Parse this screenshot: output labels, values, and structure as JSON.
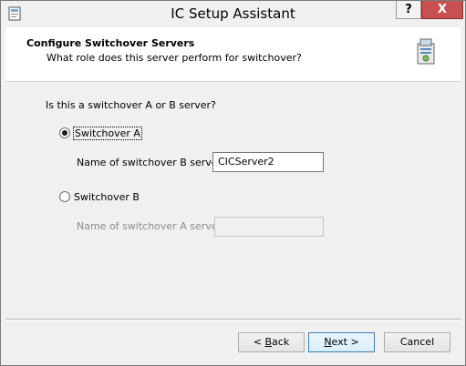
{
  "window": {
    "title": "IC Setup Assistant",
    "help_label": "?",
    "close_label": "X"
  },
  "header": {
    "title": "Configure Switchover Servers",
    "subtitle": "What role does this server perform for switchover?"
  },
  "main": {
    "question": "Is this a switchover A or B server?",
    "option_a": {
      "label": "Switchover A",
      "selected": true,
      "field_label": "Name of switchover B server:",
      "field_value": "CICServer2"
    },
    "option_b": {
      "label": "Switchover B",
      "selected": false,
      "field_label": "Name of switchover A server:",
      "field_value": ""
    }
  },
  "footer": {
    "back_prefix": "< ",
    "back_mnemonic": "B",
    "back_rest": "ack",
    "next_mnemonic": "N",
    "next_rest": "ext >",
    "cancel_label": "Cancel"
  },
  "colors": {
    "close_button": "#c75050",
    "default_button_border": "#3c7fb1",
    "disabled_text": "#8c8c8c"
  }
}
